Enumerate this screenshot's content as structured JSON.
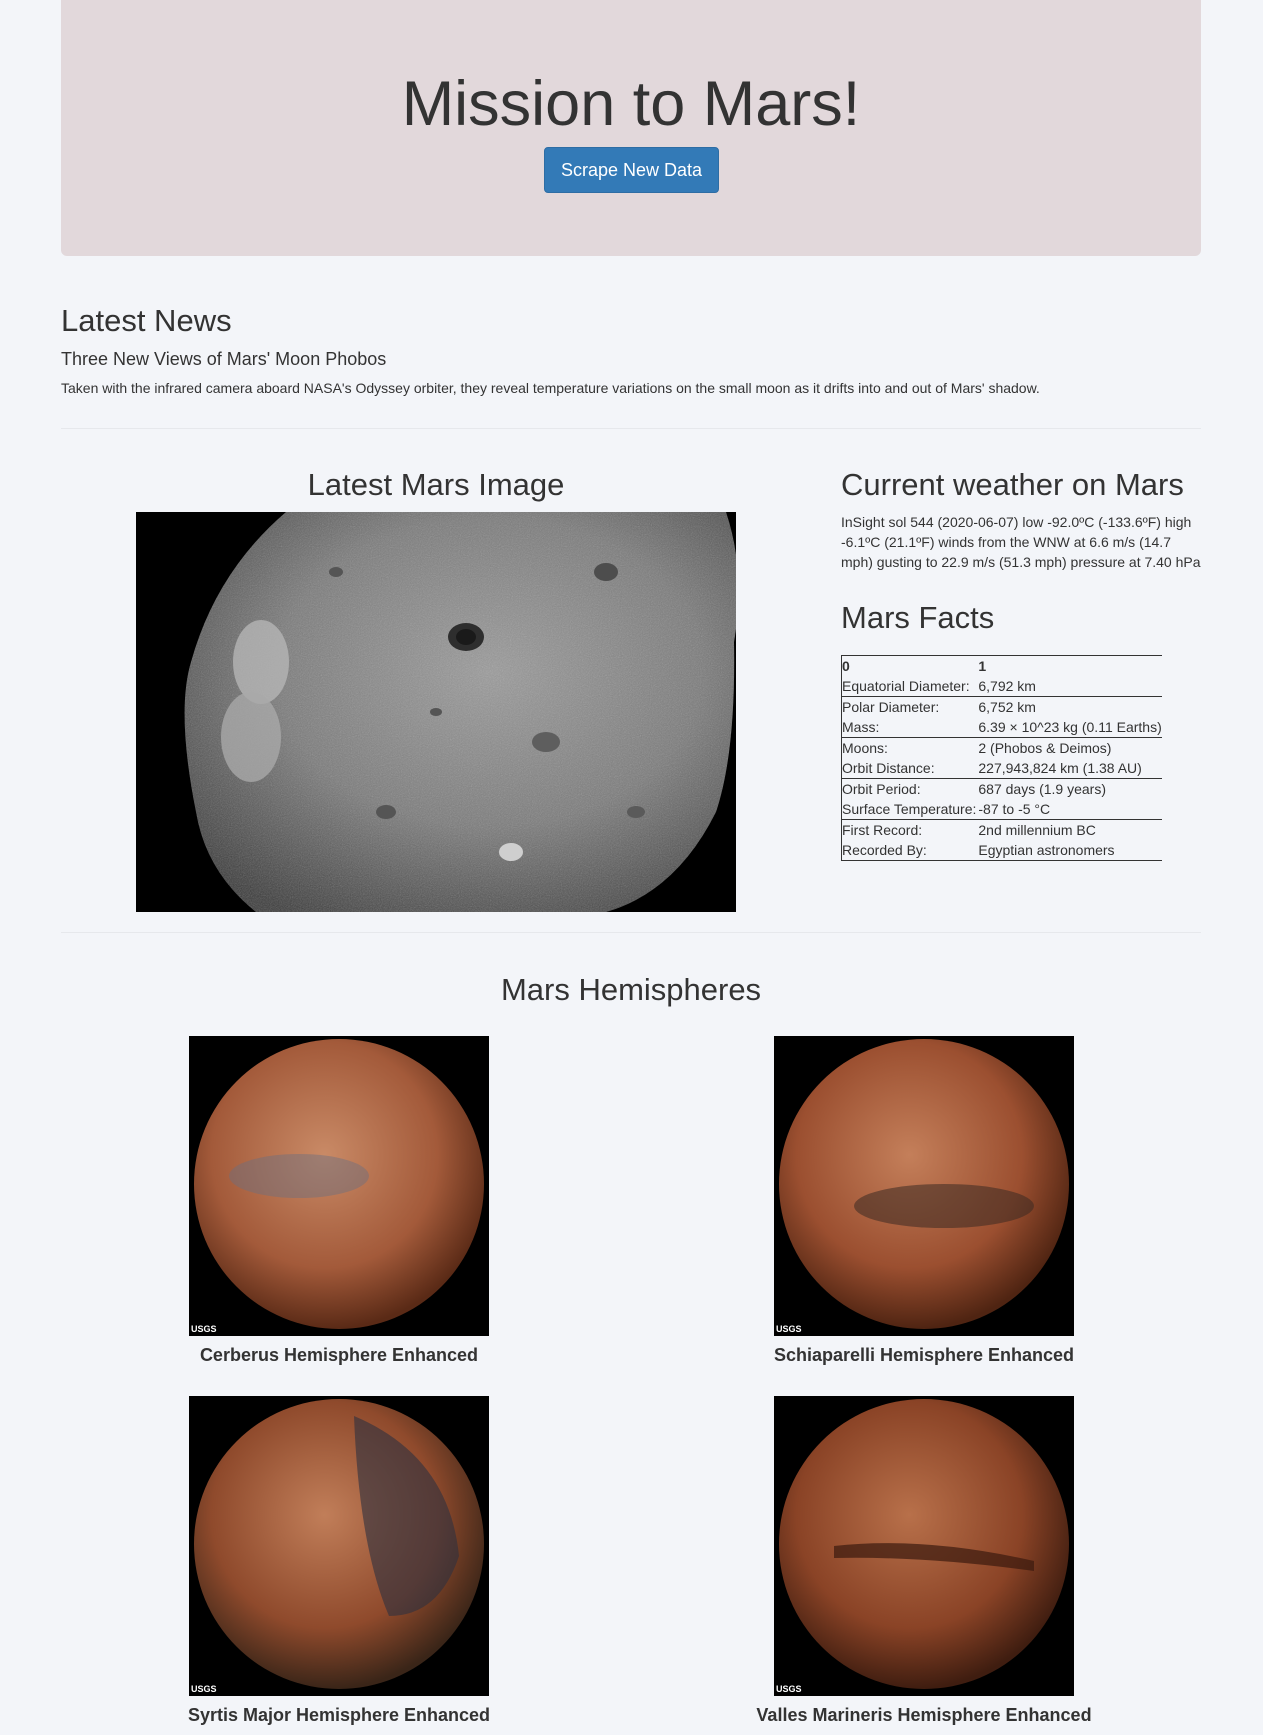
{
  "header": {
    "title": "Mission to Mars!",
    "scrape_label": "Scrape New Data"
  },
  "news": {
    "heading": "Latest News",
    "title": "Three New Views of Mars' Moon Phobos",
    "teaser": "Taken with the infrared camera aboard NASA's Odyssey orbiter, they reveal temperature variations on the small moon as it drifts into and out of Mars' shadow."
  },
  "featured_image": {
    "heading": "Latest Mars Image"
  },
  "weather": {
    "heading": "Current weather on Mars",
    "text": "InSight sol 544 (2020-06-07) low -92.0ºC (-133.6ºF) high -6.1ºC (21.1ºF) winds from the WNW at 6.6 m/s (14.7 mph) gusting to 22.9 m/s (51.3 mph) pressure at 7.40 hPa"
  },
  "facts": {
    "heading": "Mars Facts",
    "columns": [
      "0",
      "1"
    ],
    "rows": [
      {
        "key": "Equatorial Diameter:",
        "value": "6,792 km"
      },
      {
        "key": "Polar Diameter:",
        "value": "6,752 km"
      },
      {
        "key": "Mass:",
        "value": "6.39 × 10^23 kg (0.11 Earths)"
      },
      {
        "key": "Moons:",
        "value": "2 (Phobos & Deimos)"
      },
      {
        "key": "Orbit Distance:",
        "value": "227,943,824 km (1.38 AU)"
      },
      {
        "key": "Orbit Period:",
        "value": "687 days (1.9 years)"
      },
      {
        "key": "Surface Temperature:",
        "value": "-87 to -5 °C"
      },
      {
        "key": "First Record:",
        "value": "2nd millennium BC"
      },
      {
        "key": "Recorded By:",
        "value": "Egyptian astronomers"
      }
    ]
  },
  "hemispheres": {
    "heading": "Mars Hemispheres",
    "items": [
      {
        "title": "Cerberus Hemisphere Enhanced",
        "logo": "USGS"
      },
      {
        "title": "Schiaparelli Hemisphere Enhanced",
        "logo": "USGS"
      },
      {
        "title": "Syrtis Major Hemisphere Enhanced",
        "logo": "USGS"
      },
      {
        "title": "Valles Marineris Hemisphere Enhanced",
        "logo": "USGS"
      }
    ]
  }
}
